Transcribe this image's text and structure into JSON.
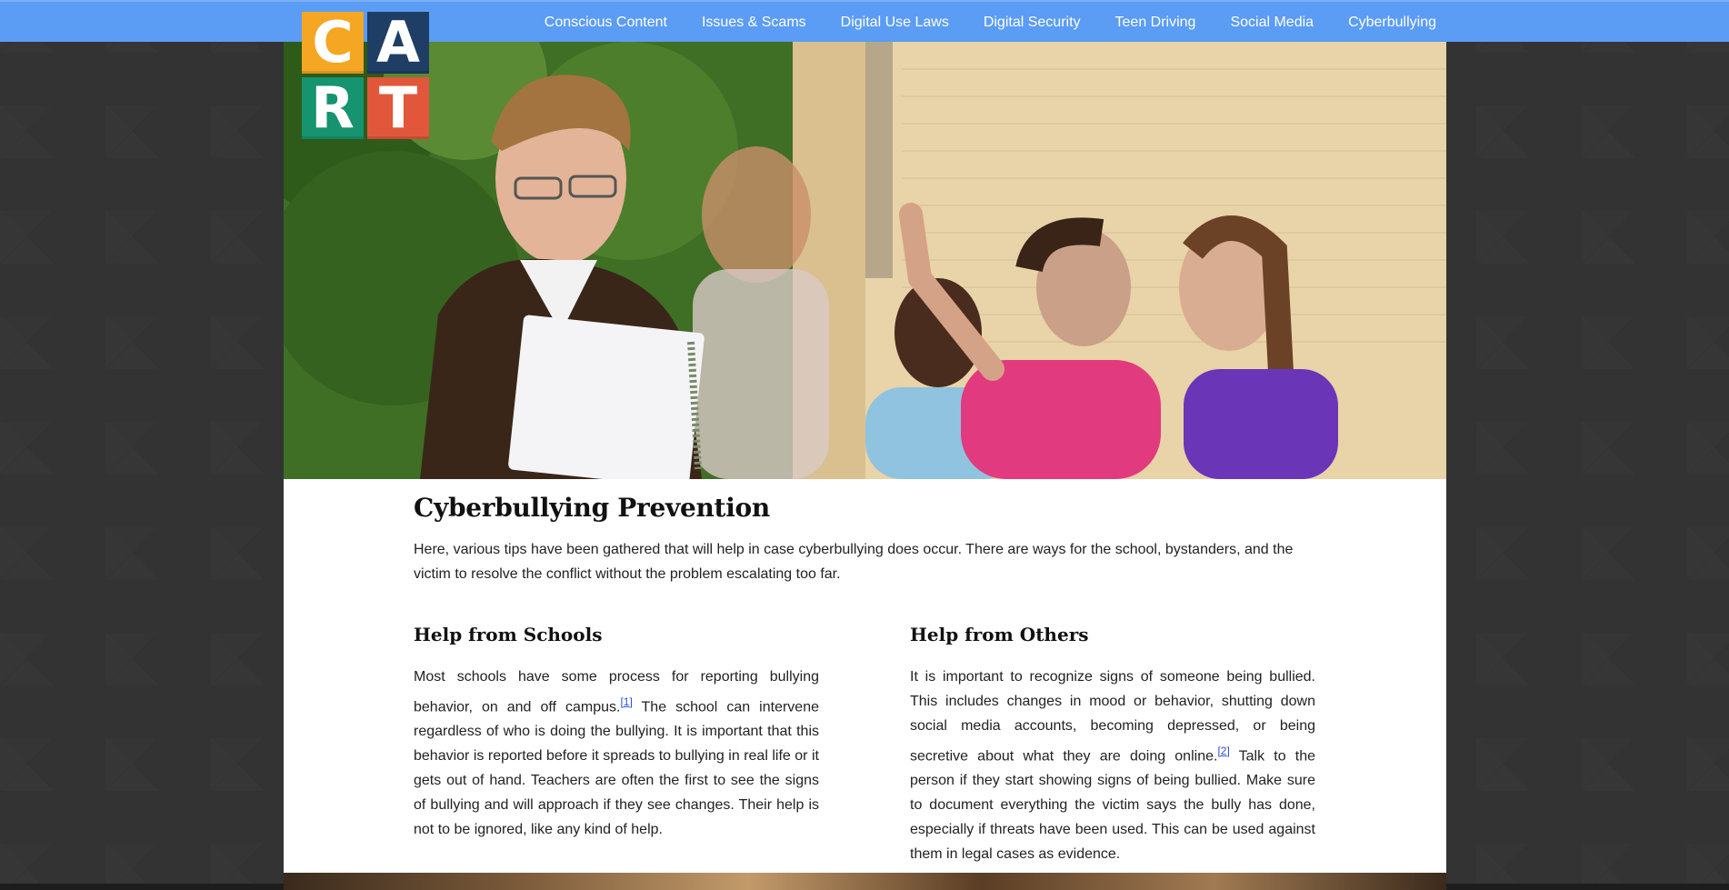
{
  "logo": {
    "letters": [
      "C",
      "A",
      "R",
      "T"
    ],
    "colors": [
      "#f5a623",
      "#1f3e66",
      "#16936f",
      "#e2573b"
    ]
  },
  "nav": {
    "items": [
      {
        "label": "Conscious Content"
      },
      {
        "label": "Issues & Scams"
      },
      {
        "label": "Digital Use Laws"
      },
      {
        "label": "Digital Security"
      },
      {
        "label": "Teen Driving"
      },
      {
        "label": "Social Media"
      },
      {
        "label": "Cyberbullying"
      }
    ],
    "bar_color": "#5b9cf5"
  },
  "main": {
    "title": "Cyberbullying Prevention",
    "intro": "Here, various tips have been gathered that will help in case cyberbullying does occur. There are ways for the school, bystanders, and the victim to resolve the conflict without the problem escalating too far.",
    "sections": [
      {
        "heading": "Help from Schools",
        "text_before": "Most schools have some process for reporting bullying behavior, on and off campus.",
        "footnote": "[1]",
        "text_after": " The school can intervene regardless of who is doing the bullying. It is important that this behavior is reported before it spreads to bullying in real life or it gets out of hand. Teachers are often the first to see the signs of bullying and will approach if they see changes. Their help is not to be ignored, like any kind of help."
      },
      {
        "heading": "Help from Others",
        "text_before": "It is important to recognize signs of someone being bullied. This includes changes in mood or behavior, shutting down social media accounts, becoming depressed, or being secretive about what they are doing online.",
        "footnote": "[2]",
        "text_after": " Talk to the person if they start showing signs of being bullied. Make sure to document everything the victim says the bully has done, especially if threats have been used. This can be used against them in legal cases as evidence."
      }
    ]
  }
}
